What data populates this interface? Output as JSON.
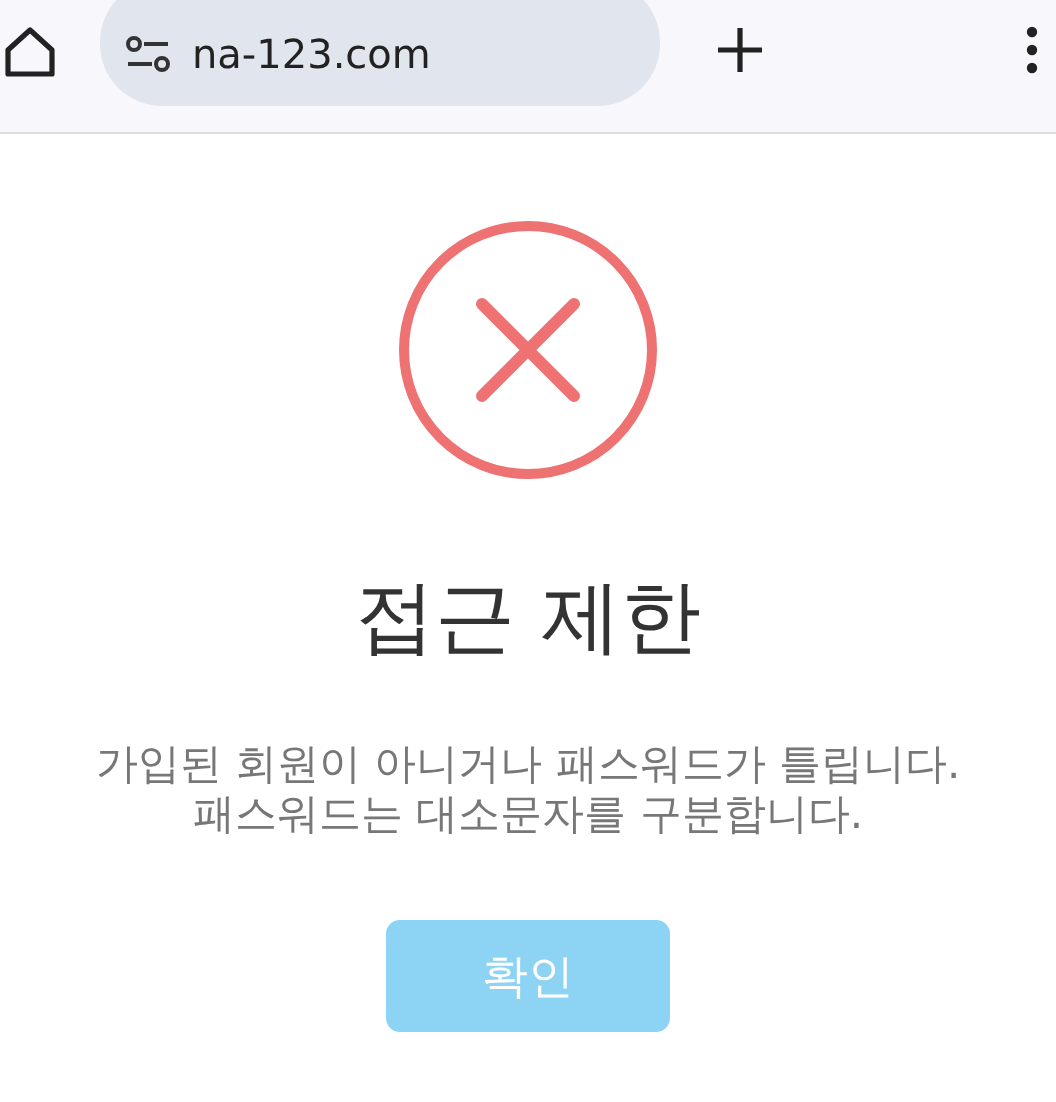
{
  "browser_toolbar": {
    "url": "na-123.com"
  },
  "dialog": {
    "title": "접근 제한",
    "message_lines": [
      "가입된 회원이 아니거나 패스워드가 틀립니다.",
      "패스워드는 대소문자를 구분합니다."
    ],
    "button": "확인"
  }
}
